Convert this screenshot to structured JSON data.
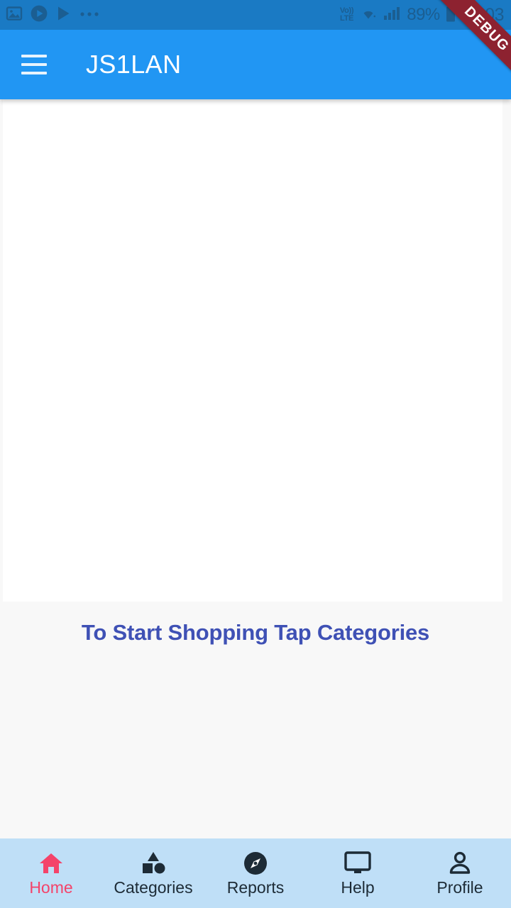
{
  "status_bar": {
    "left_icons": [
      "image-icon",
      "play-circle-icon",
      "play-store-icon",
      "more-dots-icon"
    ],
    "network_label_top": "Vo))",
    "network_label_bottom": "LTE",
    "wifi_icon": "wifi-icon",
    "signal_icon": "cellular-signal-icon",
    "battery_percent": "89%",
    "battery_icon": "battery-icon",
    "time": "11:03",
    "background_color": "#1a7ac4",
    "text_color": "#1b5e92"
  },
  "debug_banner": {
    "label": "DEBUG",
    "background_color": "#8d2230",
    "text_color": "#ffffff"
  },
  "app_bar": {
    "menu_icon": "hamburger-menu-icon",
    "title": "JS1LAN",
    "background_color": "#2196f3",
    "title_color": "#ffffff"
  },
  "main": {
    "empty_message": "To Start Shopping Tap Categories",
    "empty_message_color": "#3f51b5",
    "card_background": "#ffffff",
    "page_background": "#f8f8f8"
  },
  "bottom_nav": {
    "background_color": "#bfdff7",
    "active_color": "#f4436a",
    "inactive_color": "#1d2b36",
    "items": [
      {
        "label": "Home",
        "icon": "home-icon",
        "active": true
      },
      {
        "label": "Categories",
        "icon": "shapes-icon",
        "active": false
      },
      {
        "label": "Reports",
        "icon": "compass-icon",
        "active": false
      },
      {
        "label": "Help",
        "icon": "monitor-icon",
        "active": false
      },
      {
        "label": "Profile",
        "icon": "person-icon",
        "active": false
      }
    ]
  }
}
